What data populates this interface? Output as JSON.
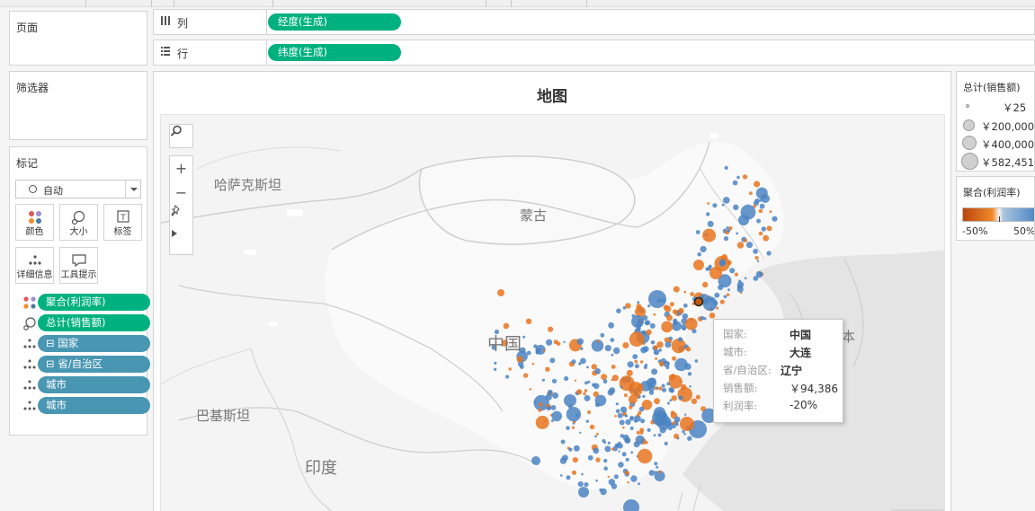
{
  "shelves": {
    "pages_title": "页面",
    "filters_title": "筛选器",
    "columns": {
      "icon": "columns-icon",
      "label": "列",
      "pill": "经度(生成)"
    },
    "rows": {
      "icon": "rows-icon",
      "label": "行",
      "pill": "纬度(生成)"
    }
  },
  "marks": {
    "title": "标记",
    "mark_type": "自动",
    "buttons": [
      {
        "label": "颜色",
        "icon": "color-dots-icon"
      },
      {
        "label": "大小",
        "icon": "size-icon"
      },
      {
        "label": "标签",
        "icon": "label-icon"
      },
      {
        "label": "详细信息",
        "icon": "detail-icon"
      },
      {
        "label": "工具提示",
        "icon": "tooltip-icon"
      }
    ],
    "fields": [
      {
        "label": "聚合(利润率)",
        "icon": "color-dots-icon",
        "color": "#00b180"
      },
      {
        "label": "总计(销售额)",
        "icon": "size-icon",
        "color": "#00b180"
      },
      {
        "label": "国家",
        "icon": "detail-icon",
        "color": "#4996b2",
        "expand": "⊟"
      },
      {
        "label": "省/自治区",
        "icon": "detail-icon",
        "color": "#4996b2",
        "expand": "⊟"
      },
      {
        "label": "城市",
        "icon": "detail-icon",
        "color": "#4996b2"
      },
      {
        "label": "城市",
        "icon": "detail-icon",
        "color": "#4996b2"
      }
    ]
  },
  "sheet": {
    "title": "地图"
  },
  "map": {
    "labels": {
      "kazakhstan": "哈萨克斯坦",
      "mongolia": "蒙古",
      "china": "中国",
      "pakistan": "巴基斯坦",
      "india": "印度",
      "japan_partial": "本"
    },
    "colors": {
      "orange": "#e8741f",
      "blue": "#4b84c2",
      "land": "#f7f7f7",
      "water": "#e6e6e6"
    }
  },
  "tooltip": {
    "country_key": "国家:",
    "country_val": "中国",
    "city_key": "城市:",
    "city_val": "大连",
    "province_key": "省/自治区:",
    "province_val": "辽宁",
    "sales_key": "销售额:",
    "sales_val": "￥94,386",
    "profit_key": "利润率:",
    "profit_val": "-20%"
  },
  "size_legend": {
    "title": "总计(销售额)",
    "items": [
      "￥25",
      "￥200,000",
      "￥400,000",
      "￥582,451"
    ]
  },
  "color_legend": {
    "title": "聚合(利润率)",
    "min": "-50%",
    "max": "50%",
    "colors": {
      "negative": "#b8460e",
      "positive": "#4b84c2"
    }
  }
}
